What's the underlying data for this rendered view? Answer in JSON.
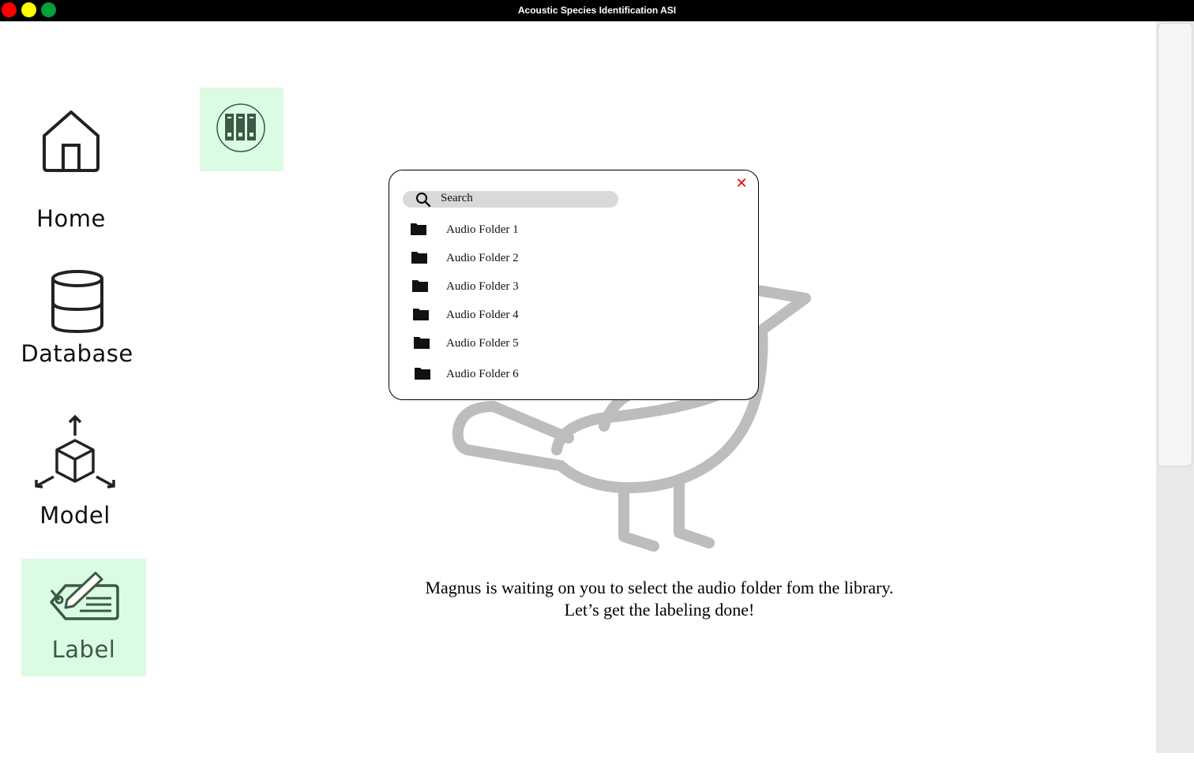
{
  "window": {
    "title": "Acoustic Species Identification ASI"
  },
  "sidebar": {
    "items": [
      {
        "label": "Home",
        "icon": "home-icon"
      },
      {
        "label": "Database",
        "icon": "database-icon"
      },
      {
        "label": "Model",
        "icon": "model-cube-icon"
      },
      {
        "label": "Label",
        "icon": "label-tag-icon",
        "active": true
      }
    ]
  },
  "library_button": {
    "icon": "library-books-icon"
  },
  "dialog": {
    "search_placeholder": "Search",
    "close_icon": "close-icon",
    "folders": [
      {
        "name": "Audio Folder 1"
      },
      {
        "name": "Audio Folder 2"
      },
      {
        "name": "Audio Folder 3"
      },
      {
        "name": "Audio Folder 4"
      },
      {
        "name": "Audio Folder 5"
      },
      {
        "name": "Audio Folder 6"
      }
    ]
  },
  "main": {
    "message_line1": "Magnus is waiting on you to select the audio folder fom the library.",
    "message_line2": "Let’s get the labeling done!"
  },
  "colors": {
    "active_bg": "#dcfbe3",
    "active_fg": "#3b5a45",
    "close": "#e00000",
    "search_bg": "#d9d9d9",
    "bird": "#bdbdbd"
  }
}
